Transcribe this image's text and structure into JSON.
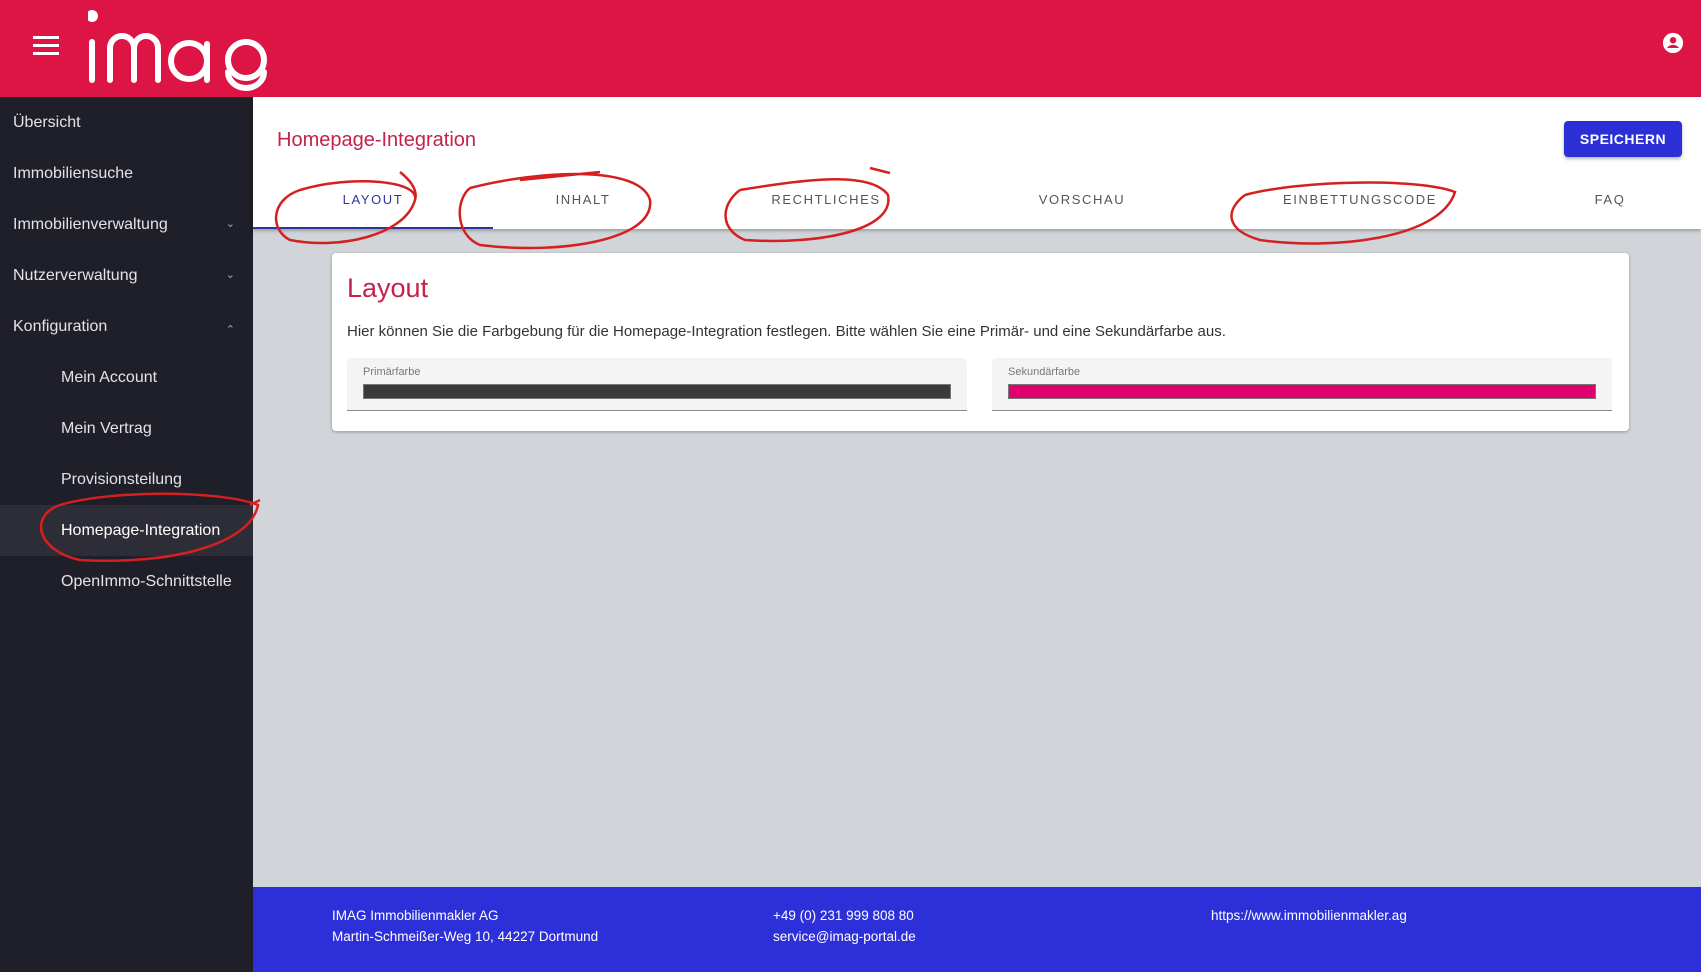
{
  "header": {
    "logo_text": "imag",
    "menu_icon": "hamburger-icon",
    "user_icon": "account-circle-icon",
    "color": "#dc1545"
  },
  "sidebar": {
    "items": [
      {
        "label": "Übersicht"
      },
      {
        "label": "Immobiliensuche"
      },
      {
        "label": "Immobilienverwaltung",
        "expandable": "collapsed"
      },
      {
        "label": "Nutzerverwaltung",
        "expandable": "collapsed"
      },
      {
        "label": "Konfiguration",
        "expandable": "expanded"
      },
      {
        "label": "Mein Account"
      },
      {
        "label": "Mein Vertrag"
      },
      {
        "label": "Provisionsteilung"
      },
      {
        "label": "Homepage-Integration",
        "active": true
      },
      {
        "label": "OpenImmo-Schnittstelle"
      }
    ]
  },
  "page": {
    "title": "Homepage-Integration",
    "save_label": "SPEICHERN",
    "tabs": [
      {
        "label": "LAYOUT"
      },
      {
        "label": "INHALT"
      },
      {
        "label": "RECHTLICHES"
      },
      {
        "label": "VORSCHAU"
      },
      {
        "label": "EINBETTUNGSCODE"
      },
      {
        "label": "FAQ"
      }
    ],
    "active_tab": "LAYOUT"
  },
  "card": {
    "title": "Layout",
    "description": "Hier können Sie die Farbgebung für die Homepage-Integration festlegen. Bitte wählen Sie eine Primär- und eine Sekundärfarbe aus.",
    "primary": {
      "label": "Primärfarbe",
      "color": "#3a3a3a"
    },
    "secondary": {
      "label": "Sekundärfarbe",
      "color": "#e0006e"
    }
  },
  "footer": {
    "company": "IMAG Immobilienmakler AG",
    "address": "Martin-Schmeißer-Weg 10, 44227 Dortmund",
    "phone": "+49 (0) 231 999 808 80",
    "email": "service@imag-portal.de",
    "website": "https://www.immobilienmakler.ag"
  }
}
